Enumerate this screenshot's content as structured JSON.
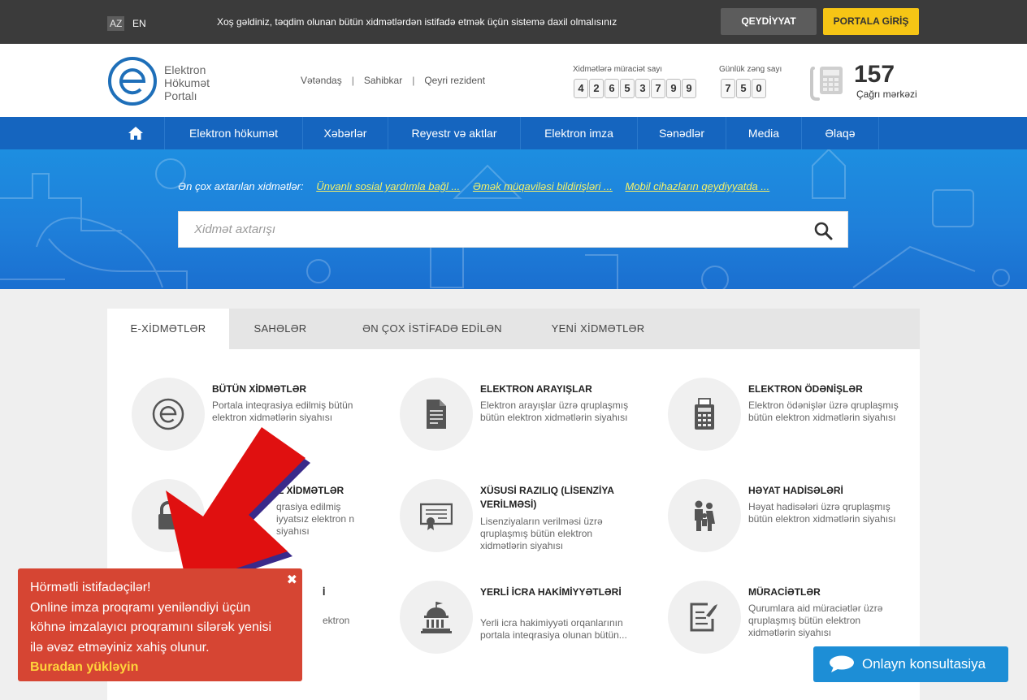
{
  "topbar": {
    "lang_az": "AZ",
    "lang_en": "EN",
    "welcome": "Xoş gəldiniz, təqdim olunan bütün xidmətlərdən istifadə etmək üçün sistemə daxil olmalısınız",
    "register": "QEYDİYYAT",
    "login": "PORTALA GİRİŞ"
  },
  "header": {
    "logo_line1": "Elektron",
    "logo_line2": "Hökumət",
    "logo_line3": "Portalı",
    "user_links": [
      "Vətəndaş",
      "Sahibkar",
      "Qeyri rezident"
    ],
    "services_counter_label": "Xidmətlərə müraciət sayı",
    "services_counter_digits": [
      "4",
      "2",
      "6",
      "5",
      "3",
      "7",
      "9",
      "9"
    ],
    "daily_calls_label": "Günlük zəng sayı",
    "daily_calls_digits": [
      "7",
      "5",
      "0"
    ],
    "hotline_number": "157",
    "hotline_label": "Çağrı mərkəzi"
  },
  "nav": {
    "home_icon": "home-icon",
    "items": [
      "Elektron hökumət",
      "Xəbərlər",
      "Reyestr və aktlar",
      "Elektron imza",
      "Sənədlər",
      "Media",
      "Əlaqə"
    ]
  },
  "hero": {
    "popular_label": "Ən çox axtarılan xidmətlər:",
    "popular_links": [
      "Ünvanlı sosial yardımla bağl ...",
      "Əmək müqaviləsi bildirişləri ...",
      "Mobil cihazların qeydiyyatda ..."
    ],
    "search_placeholder": "Xidmət axtarışı"
  },
  "tabs": [
    "E-XİDMƏTLƏR",
    "SAHƏLƏR",
    "ƏN ÇOX İSTİFADƏ EDİLƏN",
    "YENİ XİDMƏTLƏR"
  ],
  "services": [
    {
      "title": "BÜTÜN XİDMƏTLƏR",
      "desc": "Portala inteqrasiya edilmiş bütün elektron xidmətlərin siyahısı",
      "icon": "e-logo-icon"
    },
    {
      "title": "ELEKTRON ARAYIŞLAR",
      "desc": "Elektron arayışlar üzrə qruplaşmış bütün elektron xidmətlərin siyahısı",
      "icon": "document-icon"
    },
    {
      "title": "ELEKTRON ÖDƏNİŞLƏR",
      "desc": "Elektron ödənişlər üzrə qruplaşmış bütün elektron xidmətlərin siyahısı",
      "icon": "calculator-icon"
    },
    {
      "title": "L XİDMƏTLƏR",
      "desc": "qrasiya edilmiş iyyatsız elektron n siyahısı",
      "icon": "lock-icon"
    },
    {
      "title": "XÜSUSİ RAZILIQ (LİSENZİYA VERİLMƏSİ)",
      "desc": "Lisenziyaların verilməsi üzrə qruplaşmış bütün elektron xidmətlərin siyahısı",
      "icon": "certificate-icon"
    },
    {
      "title": "HƏYAT HADİSƏLƏRİ",
      "desc": "Həyat hadisələri üzrə qruplaşmış bütün elektron xidmətlərin siyahısı",
      "icon": "family-icon"
    },
    {
      "title": "İ",
      "desc": "ektron",
      "icon": "hidden-icon"
    },
    {
      "title": "YERLİ İCRA HAKİMİYYƏTLƏRİ",
      "desc": "Yerli icra hakimiyyəti orqanlarının portala inteqrasiya olunan bütün...",
      "icon": "government-building-icon"
    },
    {
      "title": "MÜRACİƏTLƏR",
      "desc": "Qurumlara aid müraciətlər üzrə qruplaşmış bütün elektron xidmətlərin siyahısı",
      "icon": "edit-document-icon"
    }
  ],
  "notice": {
    "lines": [
      "Hörmətli istifadəçilər!",
      "Online imza proqramı yeniləndiyi üçün",
      "köhnə imzalayıcı proqramını silərək yenisi",
      "ilə əvəz etməyiniz xahiş olunur."
    ],
    "link": "Buradan yükləyin",
    "close": "✖"
  },
  "consult": {
    "label": "Onlayn konsultasiya"
  },
  "colors": {
    "topbar": "#3b3b3b",
    "nav": "#1565bf",
    "login_button": "#f6c515",
    "notice": "#d64533",
    "consult": "#1d8ed6"
  }
}
